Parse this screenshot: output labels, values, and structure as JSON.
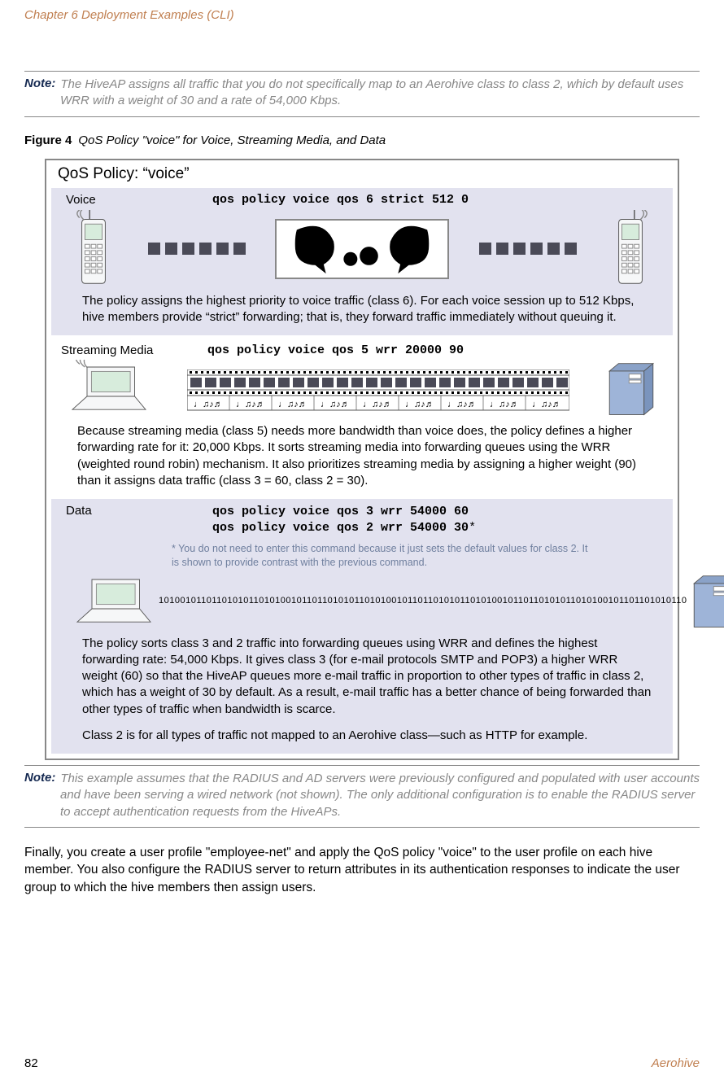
{
  "chapter_header": "Chapter 6 Deployment Examples (CLI)",
  "note1": {
    "label": "Note:",
    "text": "The HiveAP assigns all traffic that you do not specifically map to an Aerohive class to class 2, which by default uses WRR with a weight of 30 and a rate of 54,000 Kbps."
  },
  "figure_caption": {
    "bold": "Figure 4",
    "text": "QoS Policy \"voice\" for Voice, Streaming Media, and Data"
  },
  "qos_policy_title": "QoS Policy: “voice”",
  "sections": {
    "voice": {
      "label": "Voice",
      "command": "qos policy voice qos 6 strict 512 0",
      "body": "The policy assigns the highest priority to voice traffic (class 6).  For each voice session up to 512 Kbps, hive members provide “strict” forwarding; that is, they forward traffic immediately without queuing it."
    },
    "streaming": {
      "label": "Streaming Media",
      "command": "qos policy voice qos 5 wrr 20000 90",
      "body": "Because streaming media (class 5) needs more bandwidth than voice does, the policy defines a higher forwarding rate for it: 20,000 Kbps. It sorts streaming media into forwarding queues using the WRR (weighted round robin) mechanism. It also prioritizes streaming media by assigning a higher weight (90) than it assigns data traffic (class 3 = 60, class 2 = 30)."
    },
    "data": {
      "label": "Data",
      "command1": "qos policy voice qos 3 wrr 54000 60",
      "command2": "qos policy voice qos 2 wrr 54000 30",
      "asterisk": "*",
      "footnote": "* You do not need to enter this command because it just sets the default values for class 2. It is shown to provide contrast with the previous command.",
      "binary": "1010010110110101011010100101101101010110101001011011010101101010010110110101011010100101101101010110",
      "body1": "The policy sorts class 3 and 2 traffic into forwarding queues using WRR and defines the highest forwarding rate: 54,000 Kbps. It gives class 3 (for e-mail protocols SMTP and POP3) a higher WRR weight (60) so that the HiveAP queues more e-mail traffic in proportion to other types of traffic in class 2, which has a weight of 30 by default. As a result, e-mail traffic has a better chance of being forwarded than other types of traffic when bandwidth is scarce.",
      "body2": "Class 2 is for all types of traffic not mapped to an Aerohive class—such as HTTP for example."
    }
  },
  "note2": {
    "label": "Note:",
    "text": "This example assumes that the RADIUS and AD servers were previously configured and populated with user accounts and have been serving a wired network (not shown). The only additional configuration is to enable the RADIUS server to accept authentication requests from the HiveAPs."
  },
  "closing_para": "Finally, you create a user profile \"employee-net\" and apply the QoS policy \"voice\" to the user profile on each hive member. You also configure the RADIUS server to return attributes in its authentication responses to indicate the user group to which the hive members then assign users.",
  "footer": {
    "page": "82",
    "brand": "Aerohive"
  }
}
